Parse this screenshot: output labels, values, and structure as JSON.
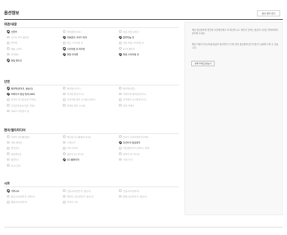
{
  "page": {
    "title": "옵션정보",
    "collapse_label": "옵션 정보 접기"
  },
  "sections": [
    {
      "title": "외관/내장",
      "options": [
        {
          "label": "선루프",
          "checked": true
        },
        {
          "label": "헤드램프(HID)",
          "checked": false
        },
        {
          "label": "파워 전동 트렁크",
          "checked": false
        },
        {
          "label": "고스트 도어 클로징",
          "checked": false
        },
        {
          "label": "전동접이 사이드 미러",
          "checked": true
        },
        {
          "label": "알루미늄 휠",
          "checked": true
        },
        {
          "label": "루프랙",
          "checked": false
        },
        {
          "label": "열선 스티어링 휠",
          "checked": false
        },
        {
          "label": "전동 조절 스티어링 휠",
          "checked": false
        },
        {
          "label": "패들 시프트",
          "checked": false
        },
        {
          "label": "스티어링 휠 리모컨",
          "checked": true
        },
        {
          "label": "ECM 룸미러",
          "checked": false
        },
        {
          "label": "하이패스",
          "checked": false
        },
        {
          "label": "파워 도어록",
          "checked": true
        },
        {
          "label": "파워 스티어링 휠",
          "checked": true
        },
        {
          "label": "파워 윈도우",
          "checked": true
        }
      ]
    },
    {
      "title": "안전",
      "options": [
        {
          "label": "에어백(운전석, 동승석)",
          "checked": true
        },
        {
          "label": "에어백(사이드)",
          "checked": false
        },
        {
          "label": "에어백(커튼)",
          "checked": false
        },
        {
          "label": "브레이크 잠김 방지(ABS)",
          "checked": true
        },
        {
          "label": "미끄럼 방지(TCS)",
          "checked": false
        },
        {
          "label": "차체자세 제어장치(ESC)",
          "checked": false
        },
        {
          "label": "타이어 공기압센서(TPMS)",
          "checked": false
        },
        {
          "label": "차선이탈 경보 시스템(LDWS)",
          "checked": false
        },
        {
          "label": "전자제어 서스펜션(ECS)",
          "checked": false
        },
        {
          "label": "주차감지센서(전방, 후방)",
          "checked": false
        },
        {
          "label": "후측방 경보 시스템",
          "checked": false
        },
        {
          "label": "후방 카메라",
          "checked": false
        },
        {
          "label": "360도 어라운드 뷰",
          "checked": false
        }
      ]
    },
    {
      "title": "편의/멀티미디어",
      "options": [
        {
          "label": "크루즈 컨트롤(일반)",
          "checked": false
        },
        {
          "label": "헤드업 디스플레이(HUD)",
          "checked": false
        },
        {
          "label": "전자식 주차브레이크(EPB)",
          "checked": false
        },
        {
          "label": "자동 에어컨",
          "checked": false
        },
        {
          "label": "스마트키",
          "checked": false
        },
        {
          "label": "무선도어 잠금장치",
          "checked": true
        },
        {
          "label": "레인센서",
          "checked": false
        },
        {
          "label": "오토 라이트",
          "checked": false
        },
        {
          "label": "커튼/블라인드(뒷좌석, 후방)",
          "checked": false
        },
        {
          "label": "내비게이션",
          "checked": false
        },
        {
          "label": "앞좌석 AV 모니터",
          "checked": false
        },
        {
          "label": "뒷좌석 AV 모니터",
          "checked": false
        },
        {
          "label": "블루투스",
          "checked": false
        },
        {
          "label": "CD 플레이어",
          "checked": true
        },
        {
          "label": "USB 단자",
          "checked": false
        },
        {
          "label": "AUX 단자",
          "checked": false
        }
      ]
    },
    {
      "title": "시트",
      "options": [
        {
          "label": "가죽시트",
          "checked": true
        },
        {
          "label": "전동시트(운전석, 동승석)",
          "checked": false
        },
        {
          "label": "전동시트(뒷좌석)",
          "checked": false
        },
        {
          "label": "열선시트(앞좌석, 뒷좌석)",
          "checked": false
        },
        {
          "label": "메모리 시트(운전석, 동승석)",
          "checked": false
        },
        {
          "label": "통풍시트(운전석, 동승석)",
          "checked": false
        },
        {
          "label": "통풍시트(뒷좌석)",
          "checked": false
        },
        {
          "label": "마사지 시트",
          "checked": false
        }
      ]
    }
  ],
  "sidebar": {
    "note_1": "해당 옵션정보를 판단에 사전확인해서 꼭 확인하시고, 확인이 안되는 옵션과 사진은 판매자에게 문의해 주세요.",
    "note_2": "해당 차량의 연식/트림/등급과 형식판단기 다를 경우 옵션정보(연식기준)가 실제와 다를 수 있습니다.",
    "button_label": "선택가격(출)정보기"
  }
}
